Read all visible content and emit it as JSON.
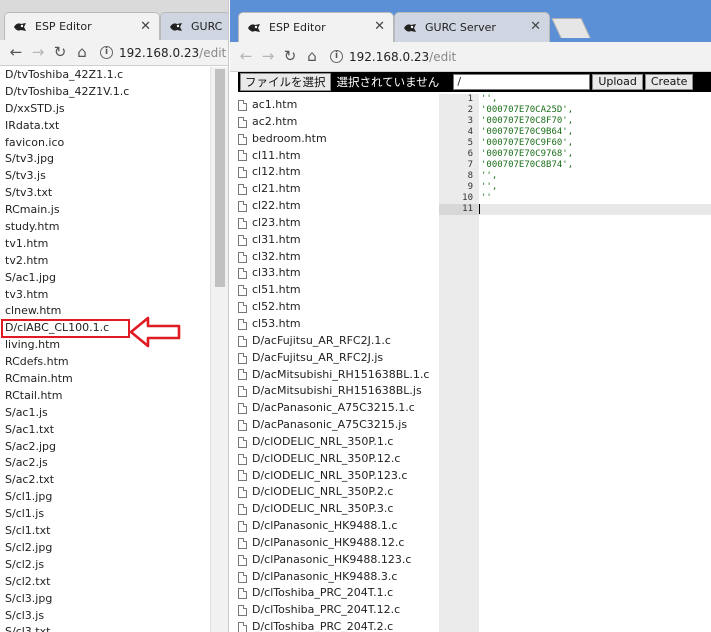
{
  "windowA": {
    "tab_active": "ESP Editor",
    "tab_inactive": "GURC",
    "address_host": "192.168.0.23",
    "address_path": "/edit",
    "files": [
      "D/tvToshiba_42Z1.1.c",
      "D/tvToshiba_42Z1V.1.c",
      "D/xxSTD.js",
      "IRdata.txt",
      "favicon.ico",
      "S/tv3.jpg",
      "S/tv3.js",
      "S/tv3.txt",
      "RCmain.js",
      "study.htm",
      "tv1.htm",
      "tv2.htm",
      "S/ac1.jpg",
      "tv3.htm",
      "clnew.htm",
      "D/clABC_CL100.1.c",
      "living.htm",
      "RCdefs.htm",
      "RCmain.htm",
      "RCtail.htm",
      "S/ac1.js",
      "S/ac1.txt",
      "S/ac2.jpg",
      "S/ac2.js",
      "S/ac2.txt",
      "S/cl1.jpg",
      "S/cl1.js",
      "S/cl1.txt",
      "S/cl2.jpg",
      "S/cl2.js",
      "S/cl2.txt",
      "S/cl3.jpg",
      "S/cl3.js",
      "S/cl3.txt"
    ],
    "highlighted_file": "D/clABC_CL100.1.c"
  },
  "windowB": {
    "tab_active": "ESP Editor",
    "tab_inactive": "GURC Server",
    "address_host": "192.168.0.23",
    "address_path": "/edit",
    "file_button": "ファイルを選択",
    "no_file": "選択されていません",
    "path_value": "/",
    "upload_label": "Upload",
    "create_label": "Create",
    "files": [
      "ac1.htm",
      "ac2.htm",
      "bedroom.htm",
      "cl11.htm",
      "cl12.htm",
      "cl21.htm",
      "cl22.htm",
      "cl23.htm",
      "cl31.htm",
      "cl32.htm",
      "cl33.htm",
      "cl51.htm",
      "cl52.htm",
      "cl53.htm",
      "D/acFujitsu_AR_RFC2J.1.c",
      "D/acFujitsu_AR_RFC2J.js",
      "D/acMitsubishi_RH151638BL.1.c",
      "D/acMitsubishi_RH151638BL.js",
      "D/acPanasonic_A75C3215.1.c",
      "D/acPanasonic_A75C3215.js",
      "D/clODELIC_NRL_350P.1.c",
      "D/clODELIC_NRL_350P.12.c",
      "D/clODELIC_NRL_350P.123.c",
      "D/clODELIC_NRL_350P.2.c",
      "D/clODELIC_NRL_350P.3.c",
      "D/clPanasonic_HK9488.1.c",
      "D/clPanasonic_HK9488.12.c",
      "D/clPanasonic_HK9488.123.c",
      "D/clPanasonic_HK9488.3.c",
      "D/clToshiba_PRC_204T.1.c",
      "D/clToshiba_PRC_204T.12.c",
      "D/clToshiba_PRC_204T.2.c"
    ],
    "editor": {
      "line_numbers": [
        "1",
        "2",
        "3",
        "4",
        "5",
        "6",
        "7",
        "8",
        "9",
        "10",
        "11"
      ],
      "lines": [
        "'',",
        "'000707E70CA25D',",
        "'000707E70C8F70',",
        "'000707E70C9B64',",
        "'000707E70C9F60',",
        "'000707E70C9768',",
        "'000707E70C8B74',",
        "'',",
        "'',",
        "''",
        ""
      ],
      "active_line": 11
    }
  },
  "colors": {
    "highlight_red": "#e01b24",
    "string_green": "#1a6f1a",
    "upload_bar": "#000000"
  }
}
